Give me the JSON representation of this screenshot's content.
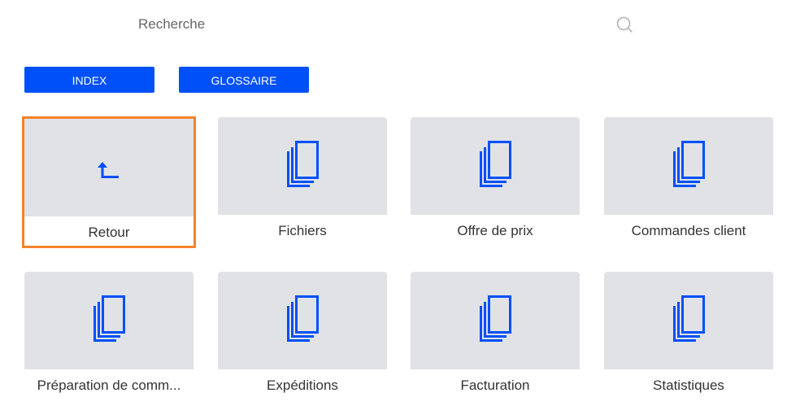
{
  "search": {
    "placeholder": "Recherche",
    "icon": "search-icon"
  },
  "buttons": {
    "index_label": "INDEX",
    "glossaire_label": "GLOSSAIRE"
  },
  "colors": {
    "accent": "#0050f8",
    "tile_bg": "#e0e2e6",
    "selection": "#f5822a",
    "icon": "#0050f8"
  },
  "tiles": [
    {
      "label": "Retour",
      "icon": "return-arrow-icon",
      "selected": true
    },
    {
      "label": "Fichiers",
      "icon": "documents-icon",
      "selected": false
    },
    {
      "label": "Offre de prix",
      "icon": "documents-icon",
      "selected": false
    },
    {
      "label": "Commandes client",
      "icon": "documents-icon",
      "selected": false
    },
    {
      "label": "Préparation de comm...",
      "icon": "documents-icon",
      "selected": false
    },
    {
      "label": "Expéditions",
      "icon": "documents-icon",
      "selected": false
    },
    {
      "label": "Facturation",
      "icon": "documents-icon",
      "selected": false
    },
    {
      "label": "Statistiques",
      "icon": "documents-icon",
      "selected": false
    }
  ]
}
